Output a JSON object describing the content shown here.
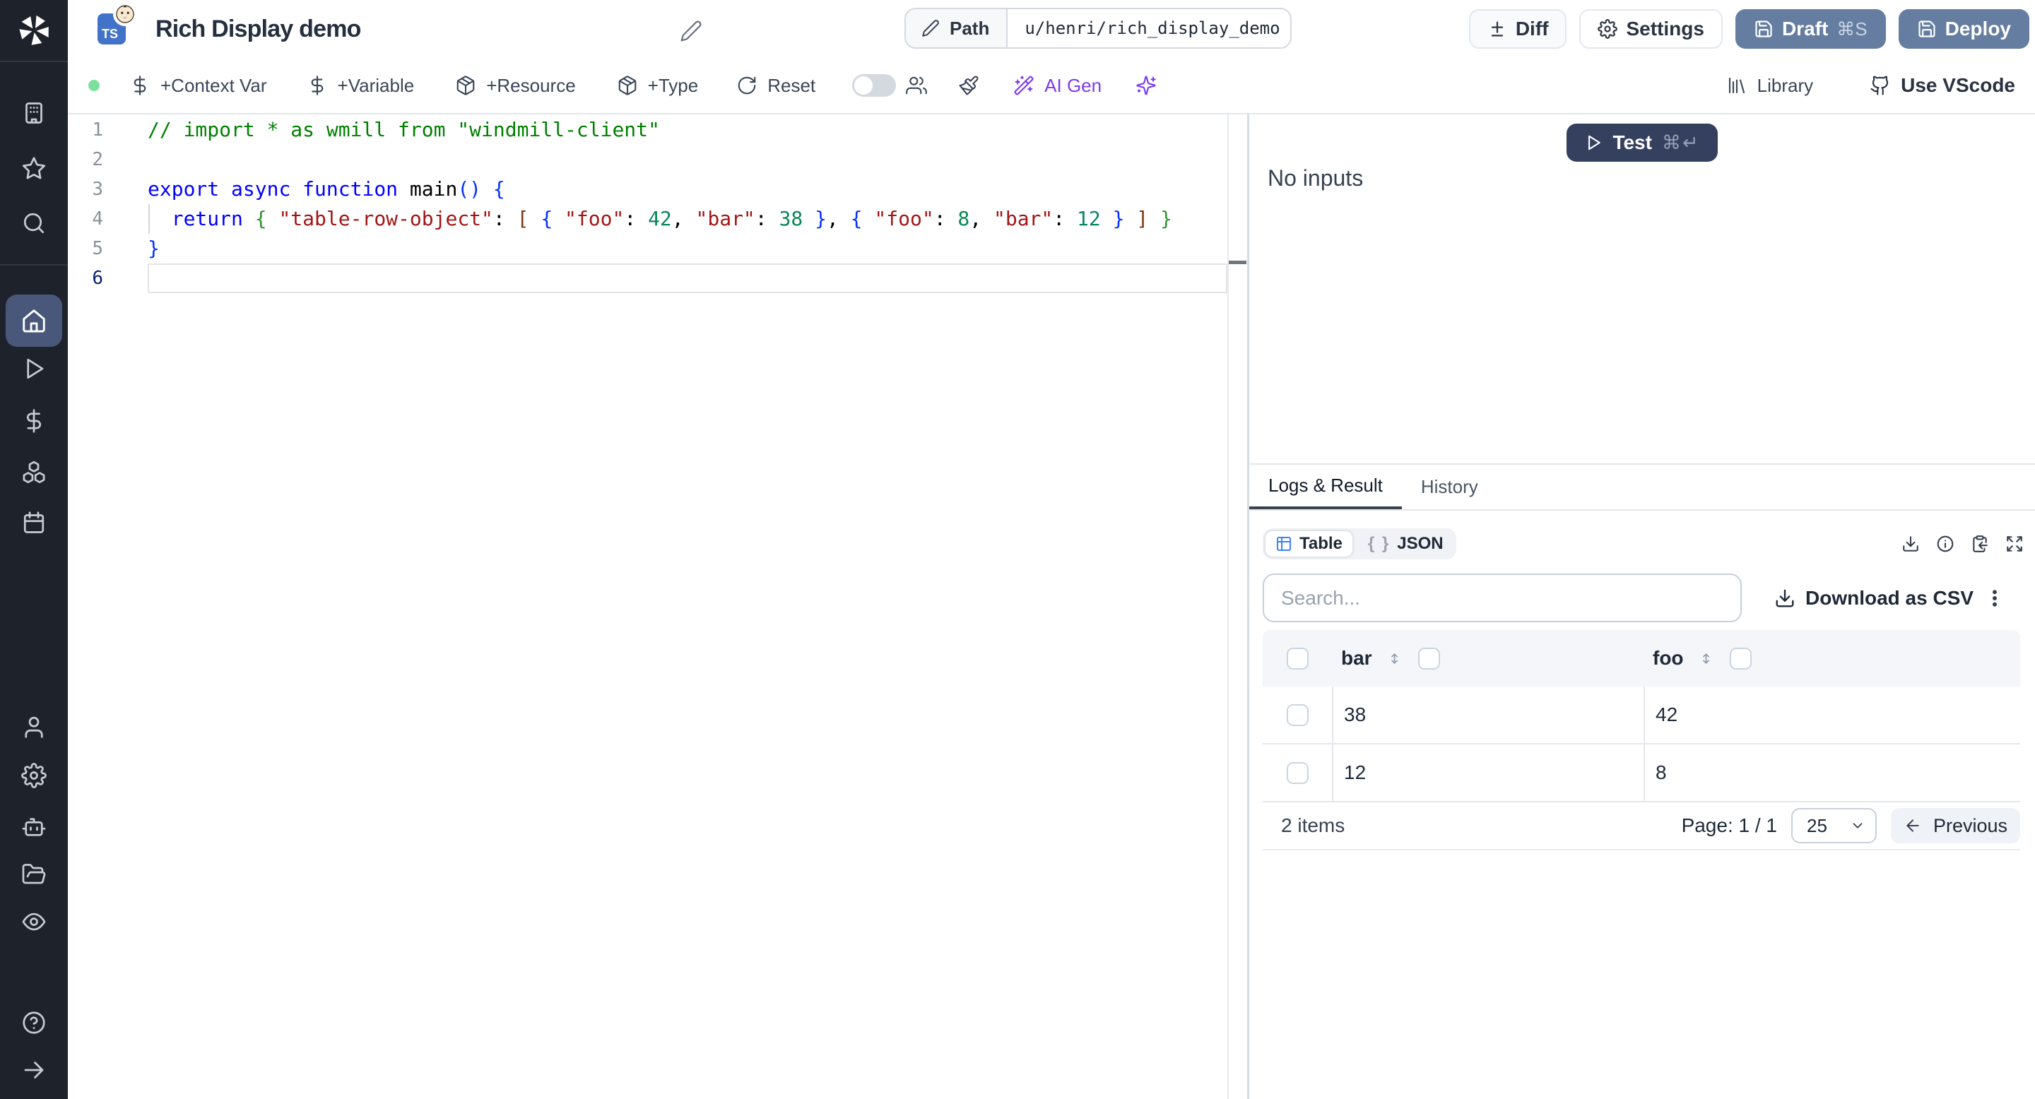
{
  "header": {
    "title": "Rich Display demo",
    "language_badge": "TS",
    "path": {
      "label": "Path",
      "value": "u/henri/rich_display_demo"
    },
    "buttons": {
      "diff": "Diff",
      "settings": "Settings",
      "draft": "Draft",
      "draft_shortcut": "⌘S",
      "deploy": "Deploy"
    }
  },
  "toolbar": {
    "context_var": "+Context Var",
    "variable": "+Variable",
    "resource": "+Resource",
    "type": "+Type",
    "reset": "Reset",
    "ai_gen": "AI Gen",
    "library": "Library",
    "use_vscode": "Use VScode",
    "status_color": "#7cdf9d",
    "accent_purple": "#7c3aed"
  },
  "sidebar": {
    "items": [
      {
        "icon": "windmill-logo"
      },
      {
        "icon": "building"
      },
      {
        "icon": "star"
      },
      {
        "icon": "search"
      },
      {
        "icon": "home",
        "active": true
      },
      {
        "icon": "play"
      },
      {
        "icon": "dollar"
      },
      {
        "icon": "boxes"
      },
      {
        "icon": "calendar"
      },
      {
        "icon": "user"
      },
      {
        "icon": "gear"
      },
      {
        "icon": "bot"
      },
      {
        "icon": "folder"
      },
      {
        "icon": "eye"
      },
      {
        "icon": "help"
      },
      {
        "icon": "arrow-right"
      }
    ]
  },
  "editor": {
    "lines": [
      {
        "num": "1",
        "tokens": [
          {
            "c": "cm",
            "t": "// import * as wmill from \"windmill-client\""
          }
        ]
      },
      {
        "num": "2",
        "tokens": []
      },
      {
        "num": "3",
        "tokens": [
          {
            "c": "kw",
            "t": "export"
          },
          {
            "c": "pl",
            "t": " "
          },
          {
            "c": "kw",
            "t": "async"
          },
          {
            "c": "pl",
            "t": " "
          },
          {
            "c": "kw",
            "t": "function"
          },
          {
            "c": "pl",
            "t": " "
          },
          {
            "c": "fn",
            "t": "main"
          },
          {
            "c": "b1",
            "t": "()"
          },
          {
            "c": "pl",
            "t": " "
          },
          {
            "c": "b1",
            "t": "{"
          }
        ]
      },
      {
        "num": "4",
        "tokens": [
          {
            "c": "pl",
            "t": "  "
          },
          {
            "c": "kw",
            "t": "return"
          },
          {
            "c": "pl",
            "t": " "
          },
          {
            "c": "b2",
            "t": "{"
          },
          {
            "c": "pl",
            "t": " "
          },
          {
            "c": "str",
            "t": "\"table-row-object\""
          },
          {
            "c": "pl",
            "t": ": "
          },
          {
            "c": "b3",
            "t": "["
          },
          {
            "c": "pl",
            "t": " "
          },
          {
            "c": "b1",
            "t": "{"
          },
          {
            "c": "pl",
            "t": " "
          },
          {
            "c": "str",
            "t": "\"foo\""
          },
          {
            "c": "pl",
            "t": ": "
          },
          {
            "c": "num",
            "t": "42"
          },
          {
            "c": "pl",
            "t": ", "
          },
          {
            "c": "str",
            "t": "\"bar\""
          },
          {
            "c": "pl",
            "t": ": "
          },
          {
            "c": "num",
            "t": "38"
          },
          {
            "c": "pl",
            "t": " "
          },
          {
            "c": "b1",
            "t": "}"
          },
          {
            "c": "pl",
            "t": ", "
          },
          {
            "c": "b1",
            "t": "{"
          },
          {
            "c": "pl",
            "t": " "
          },
          {
            "c": "str",
            "t": "\"foo\""
          },
          {
            "c": "pl",
            "t": ": "
          },
          {
            "c": "num",
            "t": "8"
          },
          {
            "c": "pl",
            "t": ", "
          },
          {
            "c": "str",
            "t": "\"bar\""
          },
          {
            "c": "pl",
            "t": ": "
          },
          {
            "c": "num",
            "t": "12"
          },
          {
            "c": "pl",
            "t": " "
          },
          {
            "c": "b1",
            "t": "}"
          },
          {
            "c": "pl",
            "t": " "
          },
          {
            "c": "b3",
            "t": "]"
          },
          {
            "c": "pl",
            "t": " "
          },
          {
            "c": "b2",
            "t": "}"
          }
        ]
      },
      {
        "num": "5",
        "tokens": [
          {
            "c": "b1",
            "t": "}"
          }
        ]
      },
      {
        "num": "6",
        "tokens": [],
        "active": true
      }
    ]
  },
  "run": {
    "test_label": "Test",
    "test_shortcut": "⌘↵",
    "no_inputs": "No inputs"
  },
  "panel": {
    "tabs": [
      {
        "label": "Logs & Result",
        "active": true
      },
      {
        "label": "History"
      }
    ],
    "views": {
      "table": "Table",
      "json": "JSON",
      "braces": "{ }"
    },
    "search_placeholder": "Search...",
    "download_csv": "Download as CSV",
    "table": {
      "columns": [
        "bar",
        "foo"
      ],
      "rows": [
        [
          "38",
          "42"
        ],
        [
          "12",
          "8"
        ]
      ],
      "items_text": "2 items",
      "page_text": "Page: 1 / 1",
      "page_size": "25",
      "previous": "Previous"
    }
  }
}
